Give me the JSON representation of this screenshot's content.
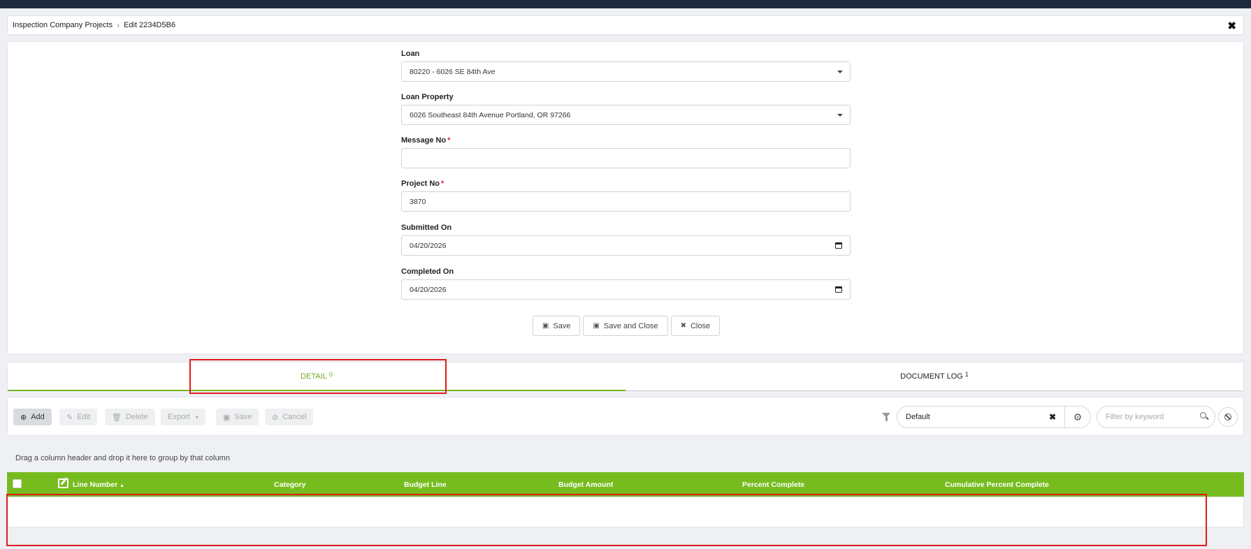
{
  "breadcrumb": {
    "parent": "Inspection Company Projects",
    "current": "Edit 2234D5B6"
  },
  "form": {
    "loan": {
      "label": "Loan",
      "value": "80220 - 6026 SE 84th Ave"
    },
    "loan_property": {
      "label": "Loan Property",
      "value": "6026 Southeast 84th Avenue Portland, OR 97266"
    },
    "message_no": {
      "label": "Message No",
      "required_mark": "*",
      "value": ""
    },
    "project_no": {
      "label": "Project No",
      "required_mark": "*",
      "value": "3870"
    },
    "submitted_on": {
      "label": "Submitted On",
      "value": "04/20/2026"
    },
    "completed_on": {
      "label": "Completed On",
      "value": "04/20/2026"
    },
    "buttons": {
      "save": "Save",
      "save_close": "Save and Close",
      "close": "Close"
    }
  },
  "tabs": [
    {
      "label": "DETAIL",
      "count": "0",
      "active": true
    },
    {
      "label": "DOCUMENT LOG",
      "count": "1",
      "active": false
    }
  ],
  "toolbar": {
    "add": "Add",
    "edit": "Edit",
    "delete": "Delete",
    "export": "Export",
    "save": "Save",
    "cancel": "Cancel",
    "view_filter": "Default",
    "search_placeholder": "Filter by keyword"
  },
  "grid": {
    "group_hint": "Drag a column header and drop it here to group by that column",
    "columns": [
      "Line Number",
      "Category",
      "Budget Line",
      "Budget Amount",
      "Percent Complete",
      "Cumulative Percent Complete"
    ],
    "sort_indicator": "▲",
    "rows": []
  },
  "colors": {
    "accent_green": "#77bc1f",
    "highlight_red": "#e01b1b",
    "topbar": "#1f2a3c"
  }
}
